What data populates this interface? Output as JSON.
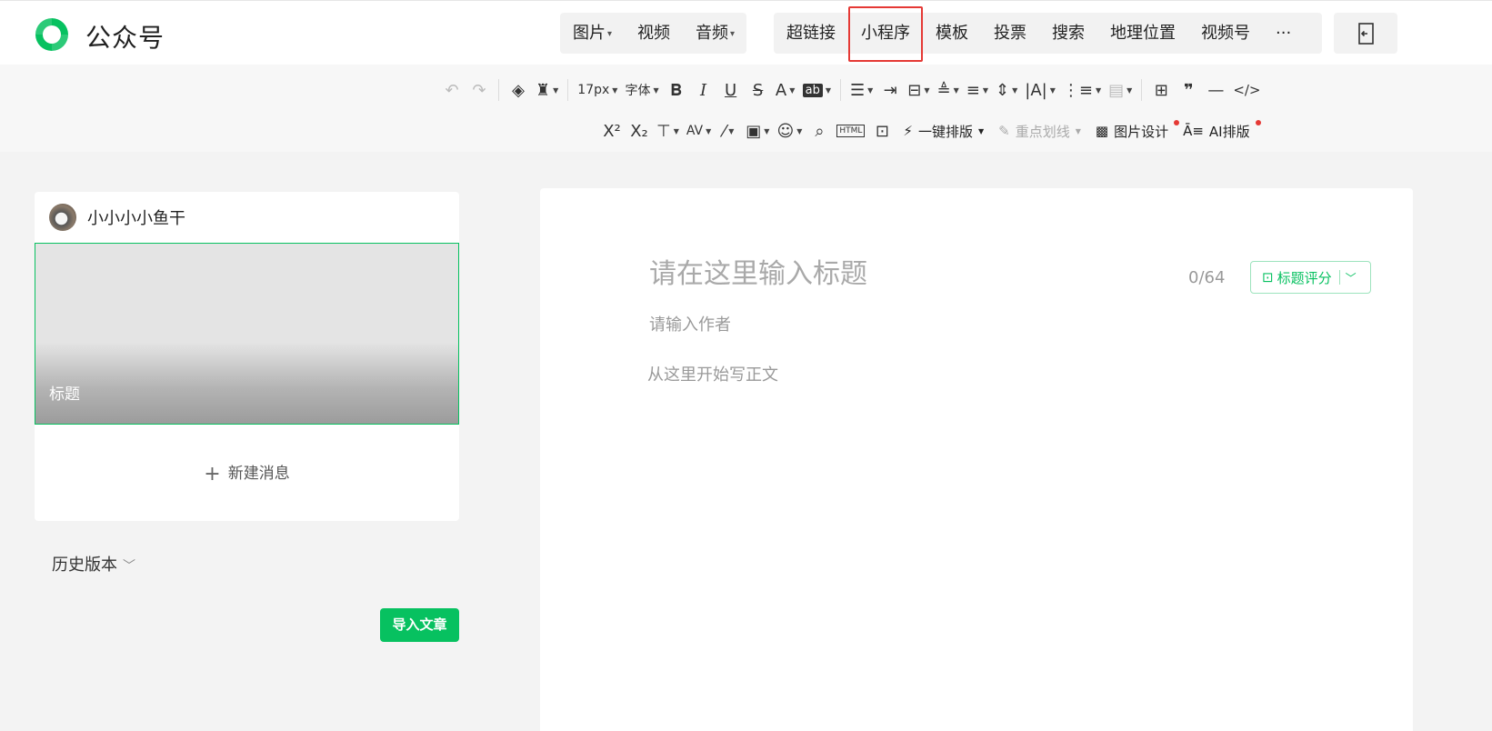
{
  "header": {
    "brand": "公众号",
    "media": [
      {
        "label": "图片",
        "dropdown": true
      },
      {
        "label": "视频",
        "dropdown": false
      },
      {
        "label": "音频",
        "dropdown": true
      }
    ],
    "insert": [
      {
        "label": "超链接"
      },
      {
        "label": "小程序",
        "highlighted": true
      },
      {
        "label": "模板"
      },
      {
        "label": "投票"
      },
      {
        "label": "搜索"
      },
      {
        "label": "地理位置"
      },
      {
        "label": "视频号"
      },
      {
        "label": "···"
      }
    ]
  },
  "toolbar": {
    "font_size": "17px",
    "font_family": "字体",
    "one_click_layout": "一键排版",
    "highlight_line": "重点划线",
    "image_design": "图片设计",
    "ai_layout": "AI排版",
    "html_label": "HTML"
  },
  "account": {
    "name": "小小小小鱼干"
  },
  "cover": {
    "title": "标题"
  },
  "new_message": "新建消息",
  "history": "历史版本",
  "import": "导入文章",
  "editor": {
    "title_placeholder": "请在这里输入标题",
    "title_count": "0/64",
    "title_score": "标题评分",
    "author_placeholder": "请输入作者",
    "body_placeholder": "从这里开始写正文"
  },
  "colors": {
    "accent": "#07c160",
    "highlight_border": "#e53935"
  }
}
